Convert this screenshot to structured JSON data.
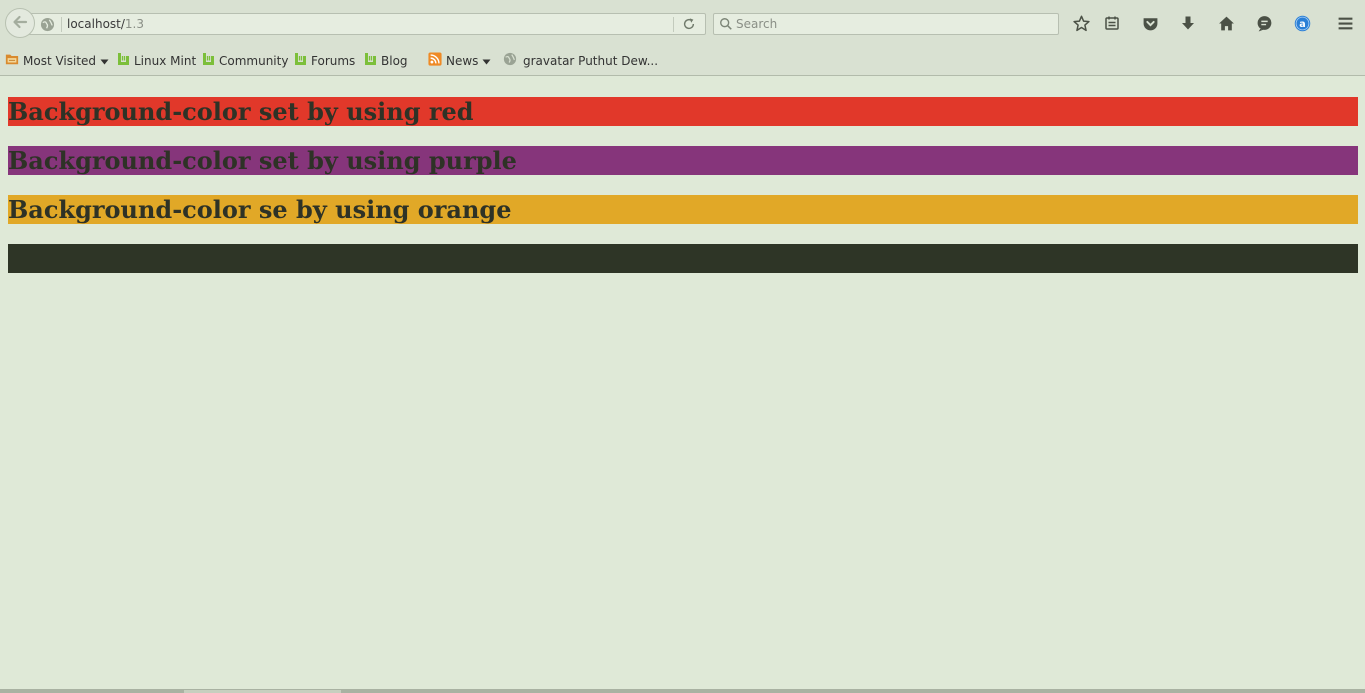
{
  "toolbar": {
    "url_host": "localhost/",
    "url_path": "1.3",
    "search_placeholder": "Search",
    "icons": [
      "back-arrow-icon",
      "globe-icon",
      "reload-icon",
      "search-icon",
      "bookmark-star-icon",
      "reading-list-icon",
      "pocket-icon",
      "download-icon",
      "home-icon",
      "chat-icon",
      "account-icon",
      "menu-icon"
    ]
  },
  "bookmarks": [
    {
      "label": "Most Visited",
      "icon": "folder-icon",
      "dropdown": true
    },
    {
      "label": "Linux Mint",
      "icon": "mint-icon"
    },
    {
      "label": "Community",
      "icon": "mint-icon"
    },
    {
      "label": "Forums",
      "icon": "mint-icon"
    },
    {
      "label": "Blog",
      "icon": "mint-icon"
    },
    {
      "label": "News",
      "icon": "rss-icon",
      "dropdown": true
    },
    {
      "label": "gravatar Puthut Dew...",
      "icon": "globe-icon"
    }
  ],
  "headings": [
    {
      "text": "Background-color set by using red",
      "color": "#e1382a"
    },
    {
      "text": "Background-color set by using purple",
      "color": "#86357b"
    },
    {
      "text": "Background-color se by using orange",
      "color": "#e1a827"
    },
    {
      "text": "",
      "color": "#2e3526"
    }
  ],
  "colors": {
    "page_background": "#dfe9d7",
    "chrome_background": "#d9e1d2",
    "heading_text": "#2e3226",
    "account_badge": "#2a7fd6"
  }
}
